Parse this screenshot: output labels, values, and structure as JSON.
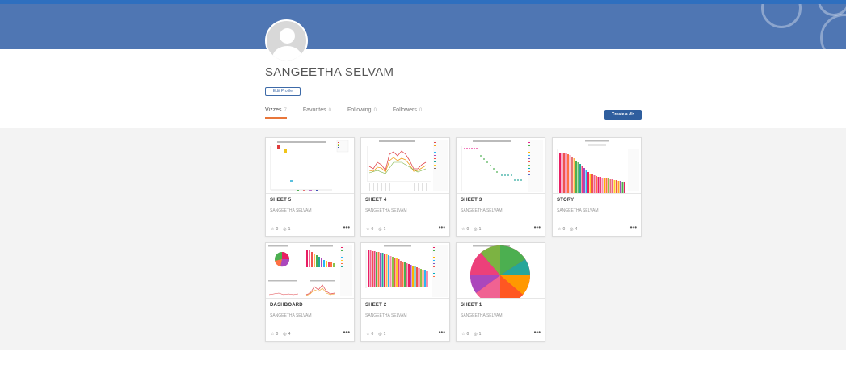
{
  "profile": {
    "name": "SANGEETHA SELVAM",
    "edit_label": "Edit Profile"
  },
  "tabs": [
    {
      "label": "Vizzes",
      "count": "7"
    },
    {
      "label": "Favorites",
      "count": "0"
    },
    {
      "label": "Following",
      "count": "0"
    },
    {
      "label": "Followers",
      "count": "0"
    }
  ],
  "create_label": "Create a Viz",
  "cards": [
    {
      "title": "SHEET 5",
      "author": "SANGEETHA SELVAM",
      "favorites": "0",
      "views": "1"
    },
    {
      "title": "SHEET 4",
      "author": "SANGEETHA SELVAM",
      "favorites": "0",
      "views": "1"
    },
    {
      "title": "SHEET 3",
      "author": "SANGEETHA SELVAM",
      "favorites": "0",
      "views": "1"
    },
    {
      "title": "STORY",
      "author": "SANGEETHA SELVAM",
      "favorites": "0",
      "views": "4"
    },
    {
      "title": "DASHBOARD",
      "author": "SANGEETHA SELVAM",
      "favorites": "0",
      "views": "4"
    },
    {
      "title": "SHEET 2",
      "author": "SANGEETHA SELVAM",
      "favorites": "0",
      "views": "1"
    },
    {
      "title": "SHEET 1",
      "author": "SANGEETHA SELVAM",
      "favorites": "0",
      "views": "1"
    }
  ],
  "colors": {
    "banner": "#4f76b3",
    "accent_tab": "#e8763a",
    "button": "#2f5e9e"
  },
  "icons": {
    "star": "star-icon",
    "views": "eye-icon",
    "more": "more-icon"
  }
}
